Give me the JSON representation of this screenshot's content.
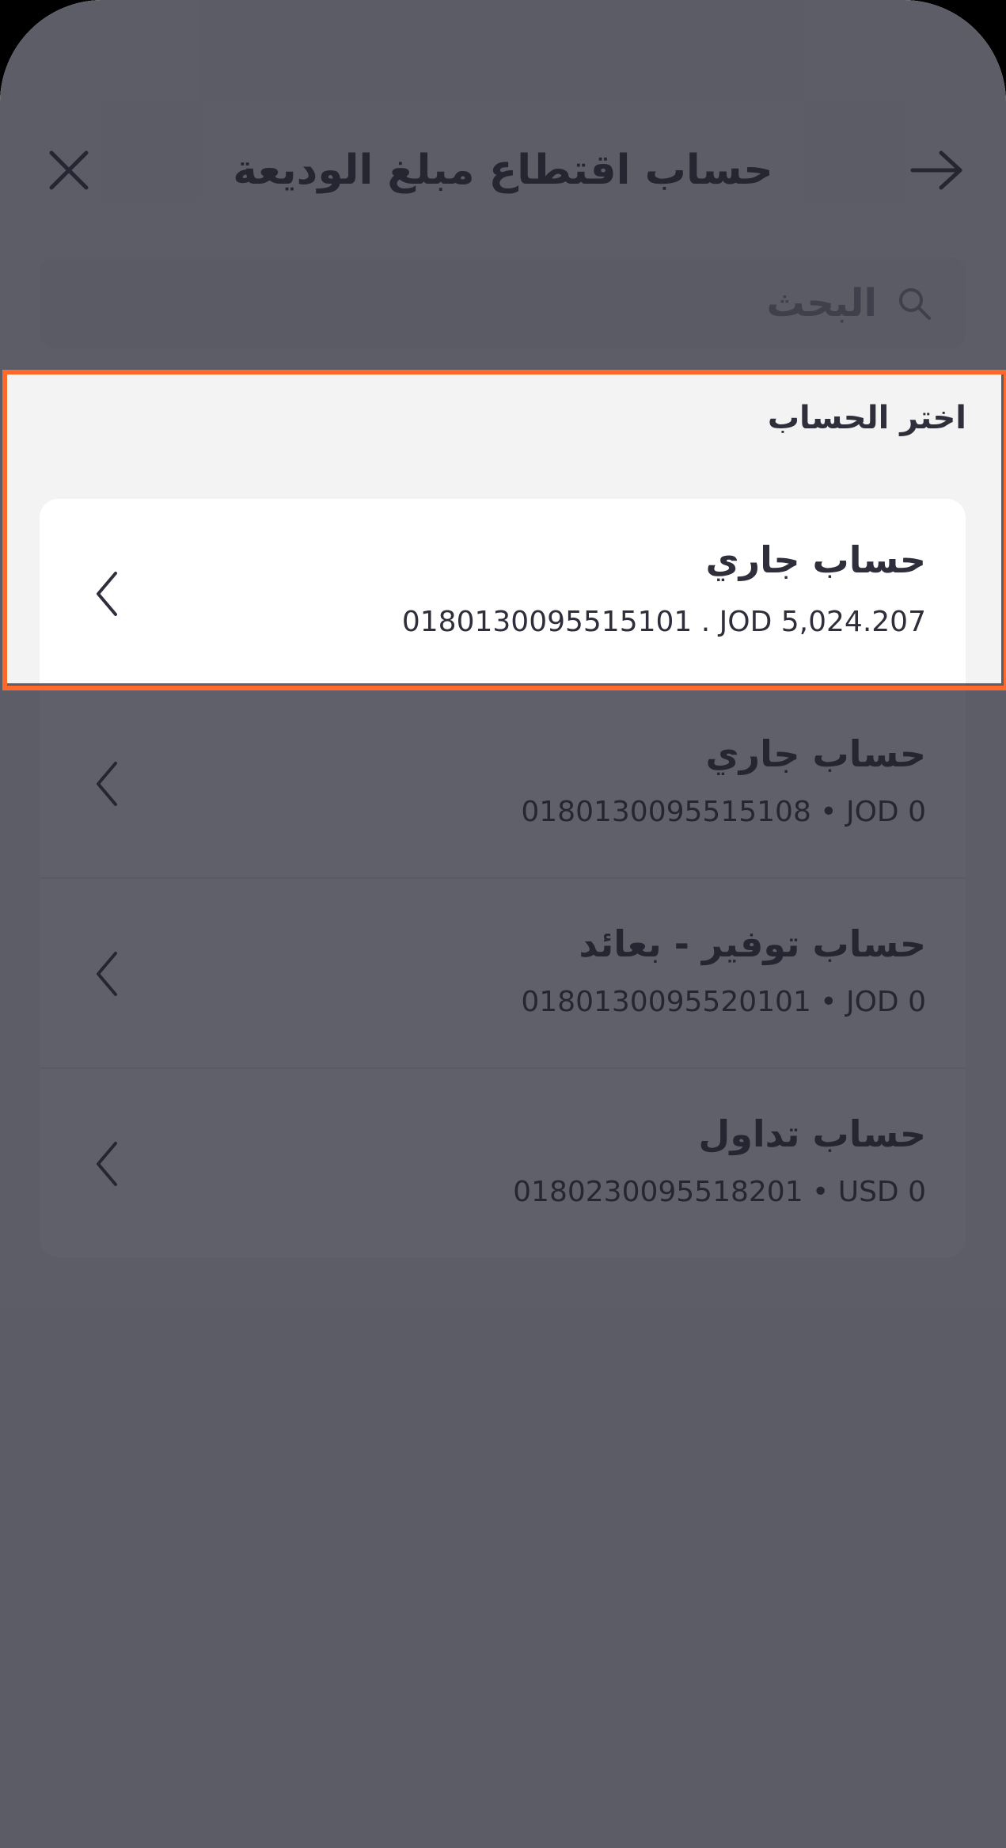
{
  "header": {
    "title": "حساب اقتطاع مبلغ الوديعة",
    "close_icon": "close-icon",
    "back_icon": "arrow-right-icon"
  },
  "search": {
    "placeholder": "البحث",
    "icon": "search-icon"
  },
  "section_label": "اختر الحساب",
  "accounts": [
    {
      "name": "حساب جاري",
      "detail": "0180130095515101 . JOD 5,024.207"
    },
    {
      "name": "حساب جاري",
      "detail": "0180130095515108 • JOD 0"
    },
    {
      "name": "حساب توفير - بعائد",
      "detail": "0180130095520101 • JOD 0"
    },
    {
      "name": "حساب تداول",
      "detail": "0180230095518201 • USD 0"
    }
  ],
  "colors": {
    "highlight_border": "#ff6a2c",
    "text": "#2f2f3b",
    "background": "#f3f3f3",
    "overlay": "#22222f"
  }
}
